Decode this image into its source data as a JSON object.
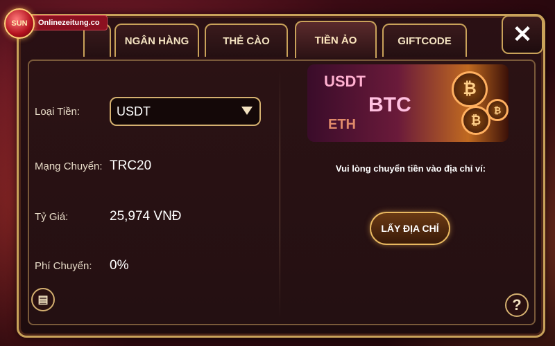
{
  "site": {
    "logo_text": "SUN",
    "domain": "Onlinezeitung.co"
  },
  "tabs": [
    {
      "label": "NGÂN HÀNG",
      "active": false
    },
    {
      "label": "THẺ CÀO",
      "active": false
    },
    {
      "label": "TIỀN ẢO",
      "active": true
    },
    {
      "label": "GIFTCODE",
      "active": false
    }
  ],
  "close_icon": "close-icon",
  "form": {
    "currency_label": "Loại Tiền:",
    "currency_value": "USDT",
    "network_label": "Mạng Chuyển:",
    "network_value": "TRC20",
    "rate_label": "Tỷ Giá:",
    "rate_value": "25,974 VNĐ",
    "fee_label": "Phí Chuyển:",
    "fee_value": "0%"
  },
  "banner": {
    "usdt": "USDT",
    "btc": "BTC",
    "eth": "ETH",
    "coin_symbol": "₿"
  },
  "instruction": "Vui lòng chuyển tiền vào địa chỉ ví:",
  "get_address_button": "LẤY ĐỊA CHỈ",
  "help_icon": "?",
  "colors": {
    "gold": "#c9a25a",
    "panel": "#241012",
    "accent": "#e8b860"
  }
}
